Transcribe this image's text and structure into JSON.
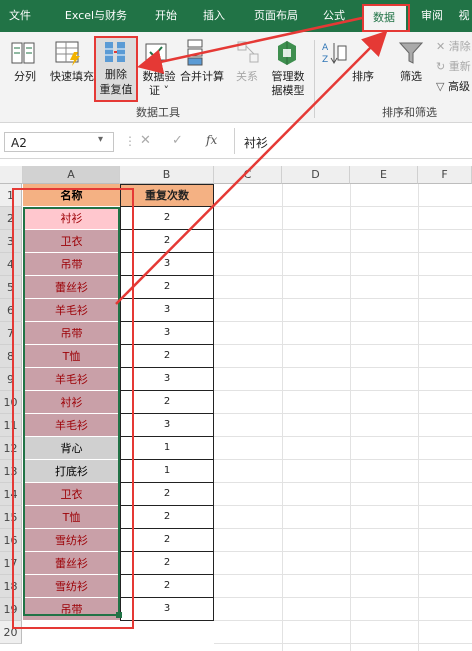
{
  "tabs": [
    {
      "label": "文件"
    },
    {
      "label": "Excel与财务"
    },
    {
      "label": "开始"
    },
    {
      "label": "插入"
    },
    {
      "label": "页面布局"
    },
    {
      "label": "公式"
    },
    {
      "label": "数据",
      "active": true
    },
    {
      "label": "审阅"
    },
    {
      "label": "视"
    }
  ],
  "ribbon": {
    "split_label": "分列",
    "flashfill_label": "快速填充",
    "remove_dup_line1": "删除",
    "remove_dup_line2": "重复值",
    "validate_line1": "数据验",
    "validate_line2": "证 ˅",
    "consolidate_label": "合并计算",
    "relations_label": "关系",
    "model_line1": "管理数",
    "model_line2": "据模型",
    "datatools_group": "数据工具",
    "sort_label": "排序",
    "filter_label": "筛选",
    "clear_label": "清除",
    "reapply_label": "重新",
    "advanced_label": "高级",
    "sortfilter_group": "排序和筛选"
  },
  "formula": {
    "namebox": "A2",
    "fx": "fx",
    "content": "衬衫"
  },
  "columns": [
    "A",
    "B",
    "C",
    "D",
    "E",
    "F"
  ],
  "rows": [
    {
      "n": "1",
      "a": "名称",
      "b": "重复次数",
      "type": "header"
    },
    {
      "n": "2",
      "a": "衬衫",
      "b": "2",
      "type": "active"
    },
    {
      "n": "3",
      "a": "卫衣",
      "b": "2",
      "type": "dup"
    },
    {
      "n": "4",
      "a": "吊带",
      "b": "3",
      "type": "dup"
    },
    {
      "n": "5",
      "a": "蕾丝衫",
      "b": "2",
      "type": "dup"
    },
    {
      "n": "6",
      "a": "羊毛衫",
      "b": "3",
      "type": "dup"
    },
    {
      "n": "7",
      "a": "吊带",
      "b": "3",
      "type": "dup"
    },
    {
      "n": "8",
      "a": "T恤",
      "b": "2",
      "type": "dup"
    },
    {
      "n": "9",
      "a": "羊毛衫",
      "b": "3",
      "type": "dup"
    },
    {
      "n": "10",
      "a": "衬衫",
      "b": "2",
      "type": "dup"
    },
    {
      "n": "11",
      "a": "羊毛衫",
      "b": "3",
      "type": "dup"
    },
    {
      "n": "12",
      "a": "背心",
      "b": "1",
      "type": "single"
    },
    {
      "n": "13",
      "a": "打底衫",
      "b": "1",
      "type": "single"
    },
    {
      "n": "14",
      "a": "卫衣",
      "b": "2",
      "type": "dup"
    },
    {
      "n": "15",
      "a": "T恤",
      "b": "2",
      "type": "dup"
    },
    {
      "n": "16",
      "a": "雪纺衫",
      "b": "2",
      "type": "dup"
    },
    {
      "n": "17",
      "a": "蕾丝衫",
      "b": "2",
      "type": "dup"
    },
    {
      "n": "18",
      "a": "雪纺衫",
      "b": "2",
      "type": "dup"
    },
    {
      "n": "19",
      "a": "吊带",
      "b": "3",
      "type": "dup"
    },
    {
      "n": "20",
      "a": "",
      "b": "",
      "type": "empty"
    }
  ],
  "colors": {
    "excel_green": "#217346",
    "dup_fill": "#c9a0a8",
    "dup_text": "#9c0006",
    "active_fill": "#ffc7ce",
    "single_fill": "#d0d0d0",
    "header_fill": "#f4b183",
    "annotation_red": "#e53935"
  }
}
